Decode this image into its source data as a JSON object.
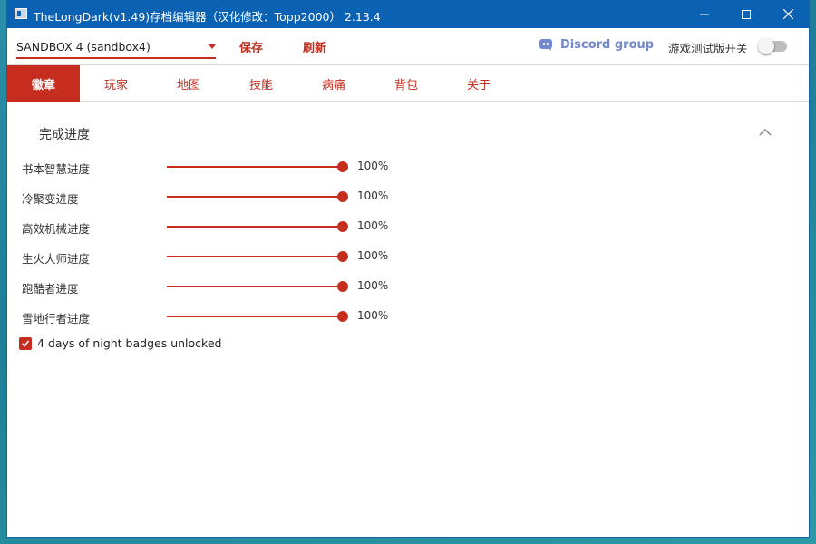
{
  "window": {
    "title": "TheLongDark(v1.49)存档编辑器（汉化修改：Topp2000） 2.13.4"
  },
  "toolbar": {
    "save_select_value": "SANDBOX 4 (sandbox4)",
    "save_label": "保存",
    "refresh_label": "刷新",
    "discord_label": "Discord group",
    "beta_toggle_label": "游戏测试版开关",
    "beta_toggle_on": false
  },
  "tabs": [
    {
      "label": "徽章",
      "active": true
    },
    {
      "label": "玩家",
      "active": false
    },
    {
      "label": "地图",
      "active": false
    },
    {
      "label": "技能",
      "active": false
    },
    {
      "label": "病痛",
      "active": false
    },
    {
      "label": "背包",
      "active": false
    },
    {
      "label": "关于",
      "active": false
    }
  ],
  "section": {
    "title": "完成进度",
    "rows": [
      {
        "label": "书本智慧进度",
        "value": "100%",
        "level": 1.0
      },
      {
        "label": "冷聚变进度",
        "value": "100%",
        "level": 1.0
      },
      {
        "label": "高效机械进度",
        "value": "100%",
        "level": 1.0
      },
      {
        "label": "生火大师进度",
        "value": "100%",
        "level": 1.0
      },
      {
        "label": "跑酷者进度",
        "value": "100%",
        "level": 1.0
      },
      {
        "label": "雪地行者进度",
        "value": "100%",
        "level": 1.0
      }
    ],
    "checkbox": {
      "label": "4 days of night badges unlocked",
      "checked": true
    }
  },
  "colors": {
    "accent": "#c62d1f",
    "titlebar": "#0b62b3",
    "discord": "#7289c9"
  },
  "icons": {
    "app": "app-icon",
    "minimize": "minimize-icon",
    "maximize": "maximize-icon",
    "close": "close-icon",
    "dropdown": "chevron-down-icon",
    "discord": "discord-icon",
    "collapse": "chevron-up-icon",
    "check": "check-icon"
  }
}
